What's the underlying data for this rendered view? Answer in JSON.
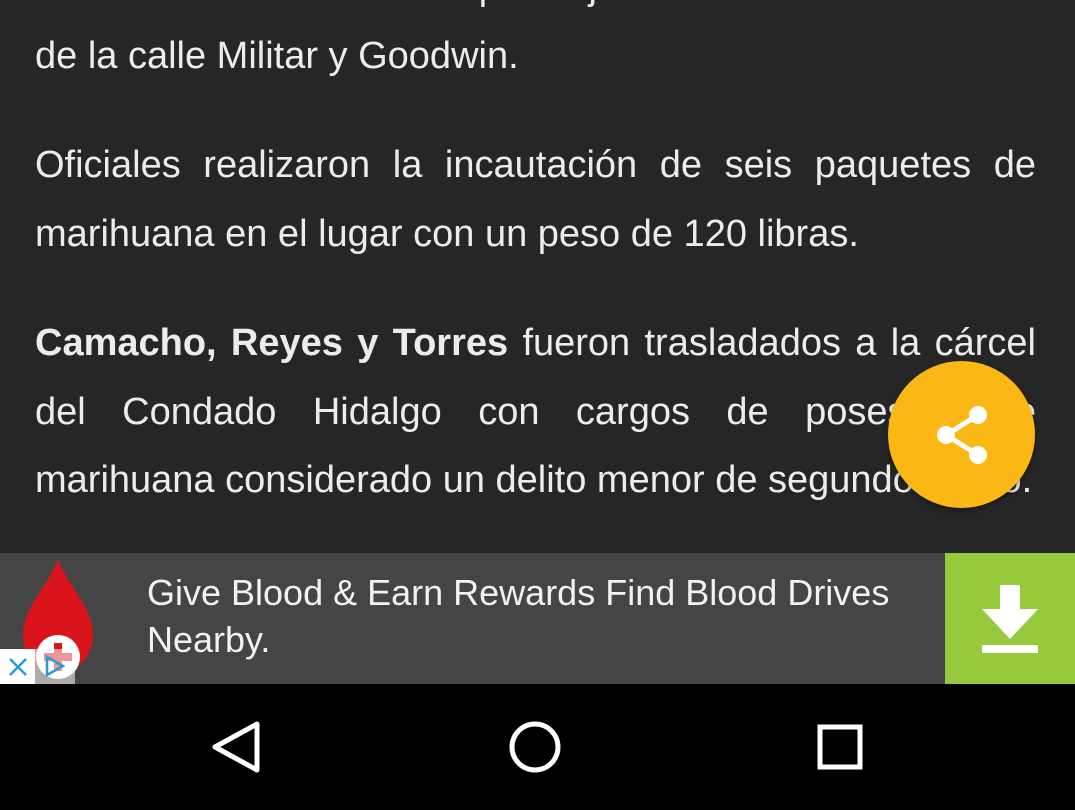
{
  "article": {
    "p1_line1": "de dos menores de edad que viajaban con ellos cerca",
    "p1_line2": "de la calle Militar y Goodwin.",
    "p2": "Oficiales realizaron la incautación de seis paquetes de marihuana en el lugar con un peso de 120 libras.",
    "p3_bold": "Camacho, Reyes y Torres",
    "p3_rest": " fueron trasladados a la cárcel del Condado Hidalgo con cargos de posesión de marihuana considerado un delito menor de segundo grado."
  },
  "share_button": {
    "icon": "share-icon",
    "color": "#fbb713"
  },
  "ad": {
    "text": "Give Blood & Earn Rewards Find Blood Drives Nearby.",
    "logo_icon": "blood-drop-icon",
    "close_icon": "close-icon",
    "adchoices_icon": "adchoices-icon",
    "download_icon": "download-icon",
    "download_color": "#97c93d"
  },
  "nav": {
    "back_icon": "back-triangle-icon",
    "home_icon": "home-circle-icon",
    "recents_icon": "recents-square-icon"
  }
}
